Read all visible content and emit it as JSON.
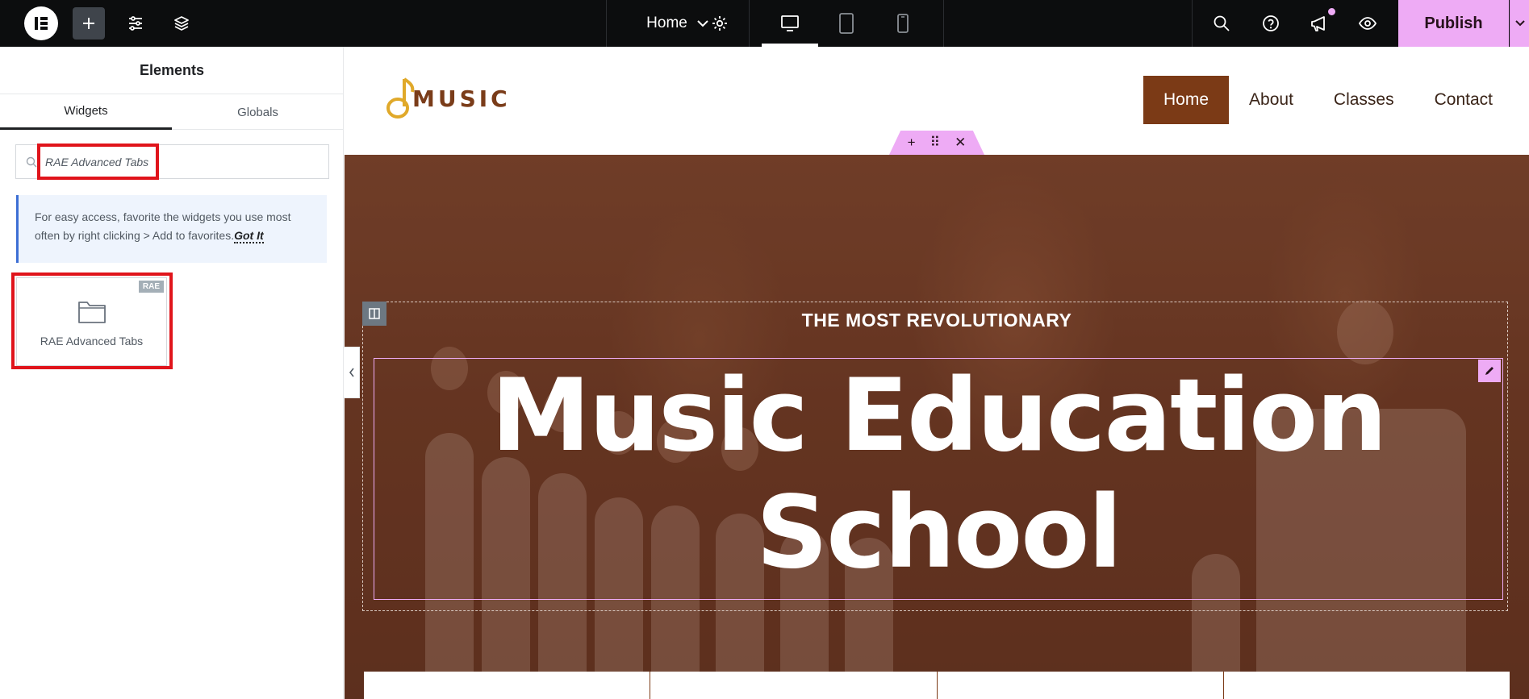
{
  "topbar": {
    "page_name": "Home",
    "publish_label": "Publish"
  },
  "panel": {
    "title": "Elements",
    "tabs": [
      {
        "label": "Widgets",
        "active": true
      },
      {
        "label": "Globals",
        "active": false
      }
    ],
    "search": {
      "value": "RAE Advanced Tabs"
    },
    "notice": {
      "text": "For easy access, favorite the widgets you use most often by right clicking > Add to favorites.",
      "link": "Got It"
    },
    "widget": {
      "label": "RAE Advanced Tabs",
      "badge": "RAE"
    }
  },
  "site": {
    "logo_text": "MUSIC",
    "nav": [
      {
        "label": "Home",
        "active": true
      },
      {
        "label": "About"
      },
      {
        "label": "Classes"
      },
      {
        "label": "Contact"
      }
    ],
    "hero": {
      "subtitle": "THE MOST REVOLUTIONARY",
      "title_line1": "Music Education",
      "title_line2": "School"
    }
  },
  "colors": {
    "accent_pink": "#eeabf5",
    "brand_brown": "#7b3a16",
    "highlight_red": "#e0141b",
    "topbar_bg": "#0c0d0e"
  }
}
